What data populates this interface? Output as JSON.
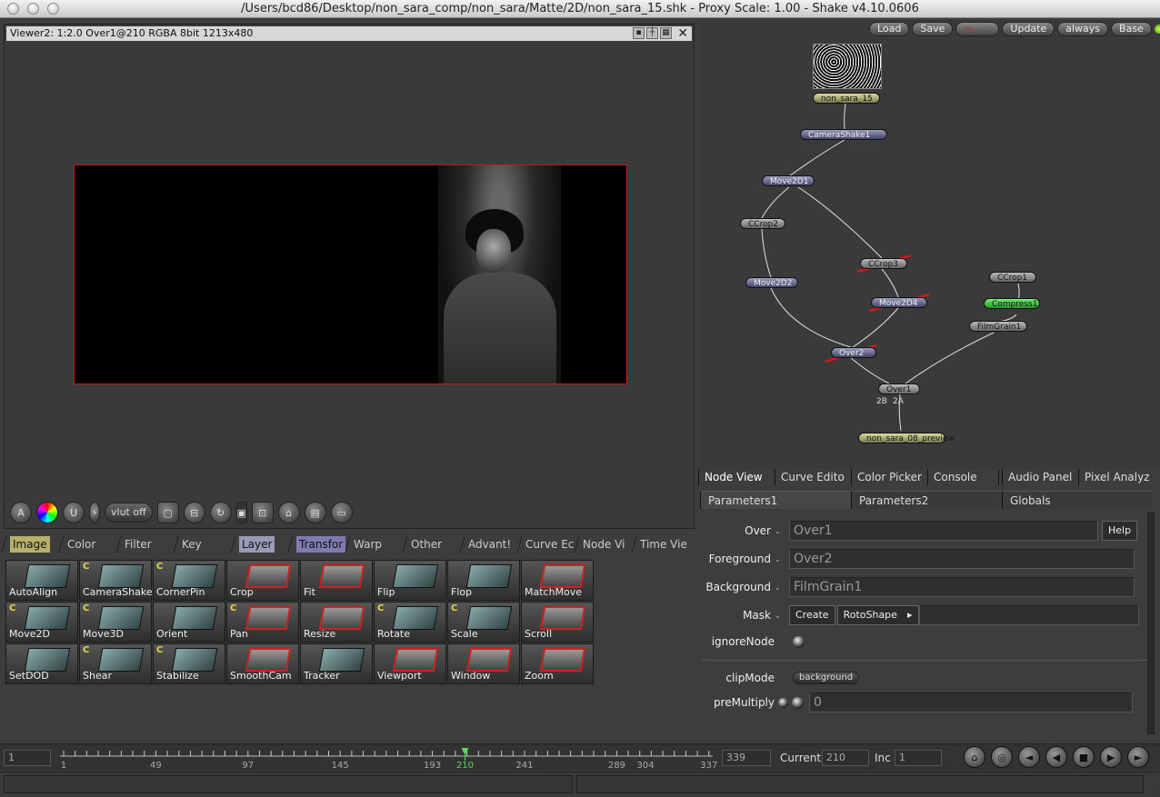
{
  "window": {
    "title": "/Users/bcd86/Desktop/non_sara_comp/non_sara/Matte/2D/non_sara_15.shk - Proxy Scale: 1.00 - Shake v4.10.0606"
  },
  "viewer": {
    "header": "Viewer2: 1:2.0 Over1@210 RGBA 8bit 1213x480",
    "vlut_label": "vlut off"
  },
  "tool_tabs": [
    "Image",
    "Color",
    "Filter",
    "Key",
    "Layer",
    "Transfor",
    "Warp",
    "Other",
    "Advant!",
    "Curve Ec",
    "Node Vi",
    "Time Vie"
  ],
  "tools": [
    {
      "label": "AutoAlign",
      "c": ""
    },
    {
      "label": "CameraShake",
      "c": "C"
    },
    {
      "label": "CornerPin",
      "c": "C"
    },
    {
      "label": "Crop",
      "c": ""
    },
    {
      "label": "Fit",
      "c": ""
    },
    {
      "label": "Flip",
      "c": ""
    },
    {
      "label": "Flop",
      "c": ""
    },
    {
      "label": "MatchMove",
      "c": ""
    },
    {
      "label": "Move2D",
      "c": "C"
    },
    {
      "label": "Move3D",
      "c": "C"
    },
    {
      "label": "Orient",
      "c": ""
    },
    {
      "label": "Pan",
      "c": "C"
    },
    {
      "label": "Resize",
      "c": ""
    },
    {
      "label": "Rotate",
      "c": "C"
    },
    {
      "label": "Scale",
      "c": "C"
    },
    {
      "label": "Scroll",
      "c": ""
    },
    {
      "label": "SetDOD",
      "c": ""
    },
    {
      "label": "Shear",
      "c": "C"
    },
    {
      "label": "Stabilize",
      "c": "C"
    },
    {
      "label": "SmoothCam",
      "c": ""
    },
    {
      "label": "Tracker",
      "c": ""
    },
    {
      "label": "Viewport",
      "c": ""
    },
    {
      "label": "Window",
      "c": ""
    },
    {
      "label": "Zoom",
      "c": ""
    }
  ],
  "node_view": {
    "buttons": [
      "Load",
      "Save",
      "Update",
      "always",
      "Base"
    ],
    "nodes": {
      "non_sara_15": "non_sara_15",
      "camerashake1": "CameraShake1",
      "move2d1": "Move2D1",
      "ccrop2": "CCrop2",
      "ccrop3": "CCrop3",
      "move2d2": "Move2D2",
      "move2d4": "Move2D4",
      "ccrop1": "CCrop1",
      "compress1": "Compress1",
      "filmgrain1": "FilmGrain1",
      "over2": "Over2",
      "over1": "Over1",
      "preview": "non_sara_08_preview"
    },
    "ports": [
      "2B",
      "2A"
    ]
  },
  "node_tabs": [
    "Node View",
    "Curve Edito",
    "Color Picker",
    "Console",
    "",
    "Audio Panel",
    "Pixel Analyz"
  ],
  "params": {
    "tabs": [
      "Parameters1",
      "Parameters2",
      "Globals"
    ],
    "over": {
      "label": "Over",
      "value": "Over1",
      "help": "Help"
    },
    "foreground": {
      "label": "Foreground",
      "value": "Over2"
    },
    "background": {
      "label": "Background",
      "value": "FilmGrain1"
    },
    "mask": {
      "label": "Mask",
      "create": "Create",
      "shape": "RotoShape"
    },
    "ignore": {
      "label": "ignoreNode"
    },
    "clipmode": {
      "label": "clipMode",
      "value": "background"
    },
    "premultiply": {
      "label": "preMultiply",
      "value": "0"
    }
  },
  "timeline": {
    "start": "1",
    "end": "339",
    "current_label": "Current",
    "current": "210",
    "inc_label": "Inc",
    "inc": "1",
    "ticks": [
      "1",
      "49",
      "97",
      "145",
      "193",
      "210",
      "241",
      "289",
      "304",
      "337"
    ]
  },
  "colors": {
    "frame": "#c81616",
    "accent": "#5fd35f"
  }
}
